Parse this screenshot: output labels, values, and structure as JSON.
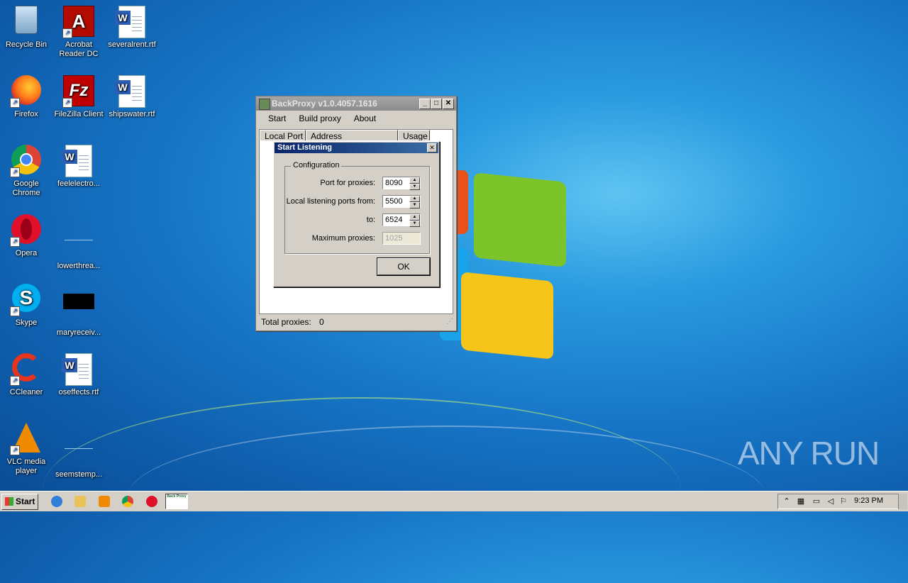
{
  "desktop": {
    "icons": [
      {
        "label": "Recycle Bin"
      },
      {
        "label": "Acrobat Reader DC"
      },
      {
        "label": "severalrent.rtf"
      },
      {
        "label": "Firefox"
      },
      {
        "label": "FileZilla Client"
      },
      {
        "label": "shipswater.rtf"
      },
      {
        "label": "Google Chrome"
      },
      {
        "label": "feelelectro..."
      },
      {
        "label": "Opera"
      },
      {
        "label": "lowerthrea..."
      },
      {
        "label": "Skype"
      },
      {
        "label": "maryreceiv..."
      },
      {
        "label": "CCleaner"
      },
      {
        "label": "oseffects.rtf"
      },
      {
        "label": "VLC media player"
      },
      {
        "label": "seemstemp..."
      }
    ]
  },
  "window": {
    "title": "BackProxy v1.0.4057.1616",
    "menu": [
      "Start",
      "Build proxy",
      "About"
    ],
    "columns": [
      "Local Port",
      "Address",
      "Usage"
    ],
    "status_label": "Total proxies:",
    "status_value": "0"
  },
  "dialog": {
    "title": "Start Listening",
    "group_label": "Configuration",
    "fields": [
      {
        "label": "Port for proxies:",
        "value": "8090"
      },
      {
        "label": "Local listening ports from:",
        "value": "5500"
      },
      {
        "label": "to:",
        "value": "6524"
      },
      {
        "label": "Maximum proxies:",
        "value": "1025"
      }
    ],
    "ok_label": "OK"
  },
  "taskbar": {
    "start_label": "Start",
    "task_label": "Back Proxy",
    "clock": "9:23 PM"
  },
  "watermark": "ANY RUN"
}
